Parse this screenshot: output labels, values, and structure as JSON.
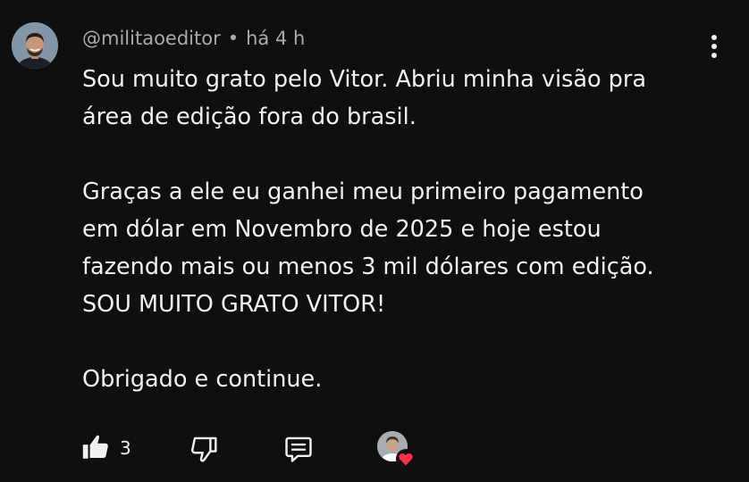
{
  "comment": {
    "author": "@militaoeditor",
    "separator": "•",
    "timestamp": "há 4 h",
    "lines": [
      "Sou muito grato pelo Vitor. Abriu minha visão pra",
      "área de edição fora do brasil.",
      "",
      "Graças a ele eu ganhei meu primeiro pagamento",
      "em dólar em Novembro de 2025 e hoje estou",
      "fazendo mais ou menos 3 mil dólares com edição.",
      "SOU MUITO GRATO VITOR!",
      "",
      "Obrigado e continue."
    ]
  },
  "actions": {
    "like_count": "3",
    "like_icon": "thumb-up-filled-icon",
    "dislike_icon": "thumb-down-icon",
    "reply_icon": "comment-icon",
    "heart_icon": "heart-icon"
  },
  "colors": {
    "background": "#0f0f0f",
    "text": "#f1f1f1",
    "meta": "#aaaaaa",
    "heart": "#ff2e4d"
  }
}
